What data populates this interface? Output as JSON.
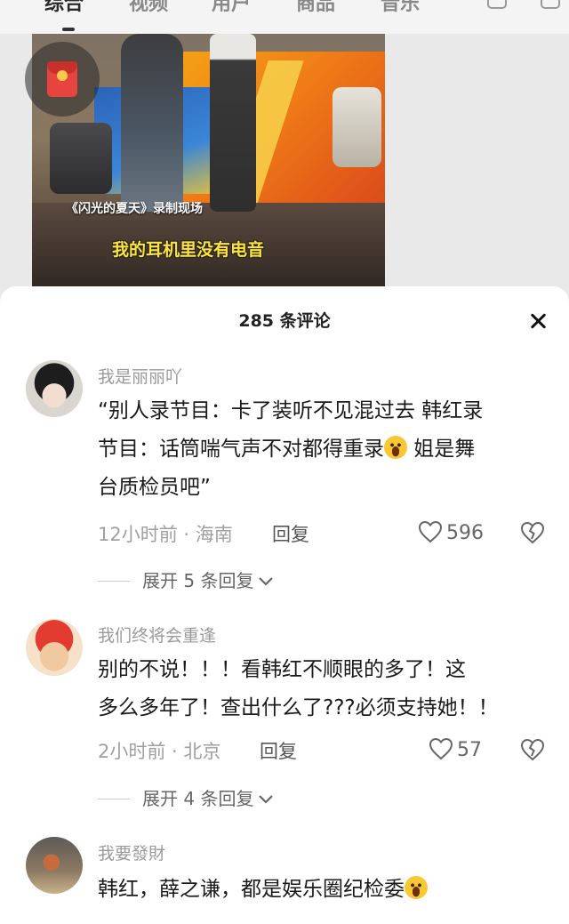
{
  "tabs": [
    {
      "label": "综合",
      "active": true
    },
    {
      "label": "视频",
      "active": false
    },
    {
      "label": "用户",
      "active": false
    },
    {
      "label": "商品",
      "active": false
    },
    {
      "label": "音乐",
      "active": false
    }
  ],
  "video": {
    "caption": "《闪光的夏天》录制现场",
    "subtitle": "我的耳机里没有电音"
  },
  "comments_panel": {
    "title": "285 条评论"
  },
  "comments": [
    {
      "username": "我是丽丽吖",
      "text_line1": "“别人录节目：卡了装听不见混过去 韩红录",
      "text_line2": "节目：话筒喘气声不对都得重录",
      "text_line2_after": " 姐是舞",
      "text_line3": "台质检员吧”",
      "emoji_icon": "rolling-laughing-emoji",
      "time": "12小时前 · 海南",
      "reply_label": "回复",
      "likes": "596",
      "expand_label": "展开 5 条回复"
    },
    {
      "username": "我们终将会重逢",
      "text_line1": "别的不说！！！看韩红不顺眼的多了！这",
      "text_line2": "多么多年了！查出什么了???必须支持她！！",
      "time": "2小时前 · 北京",
      "reply_label": "回复",
      "likes": "57",
      "expand_label": "展开 4 条回复"
    },
    {
      "username": "我要發財",
      "text_line1": "韩红，薛之谦，都是娱乐圈纪检委",
      "emoji_icon": "crying-laughing-emoji"
    }
  ],
  "colors": {
    "accent_text": "#1a1a1a",
    "meta_text": "#a0a0a0",
    "sheet_bg": "#ffffff"
  }
}
